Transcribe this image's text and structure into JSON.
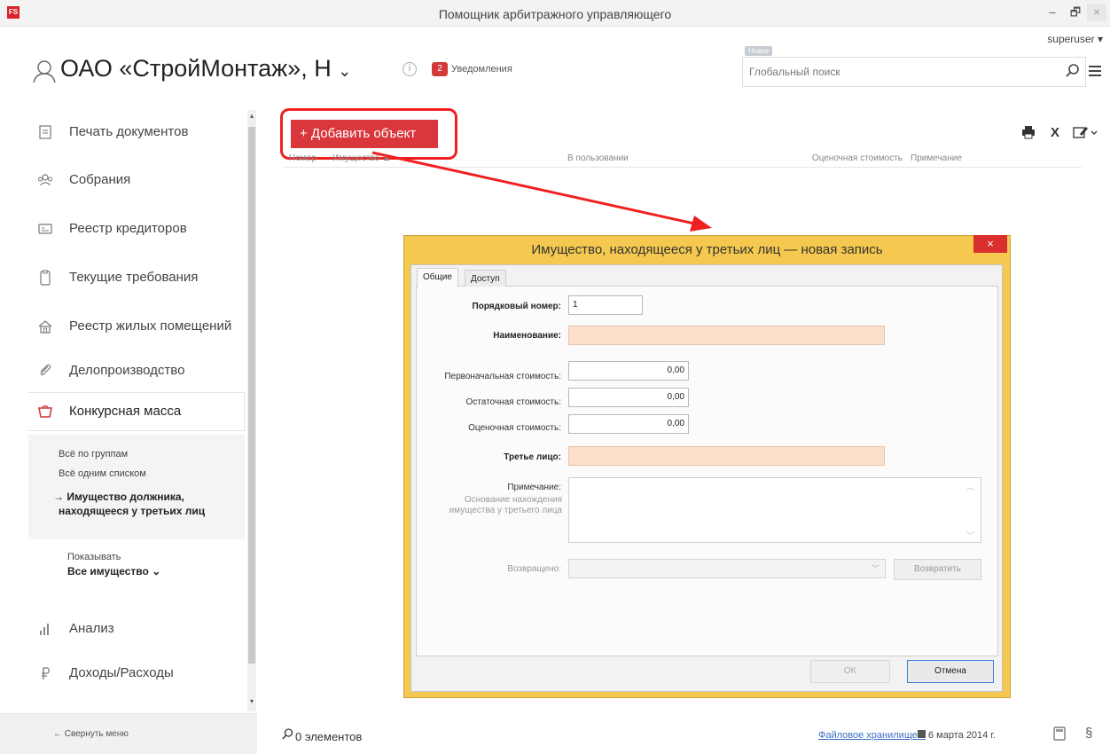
{
  "window": {
    "title": "Помощник арбитражного управляющего",
    "app_icon": "FS",
    "minimize": "‒",
    "maximize": "🗗",
    "close": "×"
  },
  "header": {
    "user": "superuser ▾",
    "org_title": "ОАО «СтройМонтаж», Н",
    "org_chevron": "⌄",
    "info": "i",
    "notifications_count": "2",
    "notifications_label": "Уведомления",
    "new_tag": "Новое",
    "search_placeholder": "Глобальный поиск"
  },
  "sidebar": {
    "items": [
      {
        "label": "Печать документов",
        "icon": "document-icon"
      },
      {
        "label": "Собрания",
        "icon": "meeting-icon"
      },
      {
        "label": "Реестр кредиторов",
        "icon": "card-icon"
      },
      {
        "label": "Текущие требования",
        "icon": "clipboard-icon"
      },
      {
        "label": "Реестр жилых помещений",
        "icon": "house-icon"
      },
      {
        "label": "Делопроизводство",
        "icon": "paperclip-icon"
      },
      {
        "label": "Конкурсная масса",
        "icon": "bag-icon"
      },
      {
        "label": "Анализ",
        "icon": "bar-chart-icon"
      },
      {
        "label": "Доходы/Расходы",
        "icon": "ruble-icon"
      }
    ],
    "sub_items": [
      "Всё по группам",
      "Всё одним списком"
    ],
    "sub_active_line1": "→ Имущество должника,",
    "sub_active_line2": "находящееся у третьих лиц",
    "show_label": "Показывать",
    "show_value": "Все имущество ⌄",
    "collapse": "← Свернуть меню",
    "scroll_up": "▴",
    "scroll_down": "▾"
  },
  "main": {
    "add_button": "+ Добавить объект",
    "columns": [
      "Номер",
      "Имущество ▲",
      "В пользовании",
      "Оценочная стоимость",
      "Примечание"
    ],
    "excel": "X",
    "status_count": "0 элементов",
    "storage_link": "Файловое хранилище...",
    "date": "6 марта 2014 г.",
    "paragraph": "§"
  },
  "dialog": {
    "title": "Имущество, находящееся у третьих лиц — новая запись",
    "close": "×",
    "tabs": [
      "Общие",
      "Доступ"
    ],
    "fields": {
      "order_label": "Порядковый номер:",
      "order_value": "1",
      "name_label": "Наименование:",
      "initial_label": "Первоначальная стоимость:",
      "initial_value": "0,00",
      "residual_label": "Остаточная стоимость:",
      "residual_value": "0,00",
      "estimated_label": "Оценочная стоимость:",
      "estimated_value": "0,00",
      "third_party_label": "Третье лицо:",
      "note_label": "Примечание:",
      "note_hint": "Основание нахождения имущества у третьего лица",
      "returned_label": "Возвращено:"
    },
    "return_button": "Возвратить",
    "ok_button": "OK",
    "cancel_button": "Отмена"
  },
  "colors": {
    "accent_red": "#d9373c",
    "dialog_frame": "#f5c84f",
    "required_field": "#fce0cc",
    "annotation": "#f02020"
  }
}
